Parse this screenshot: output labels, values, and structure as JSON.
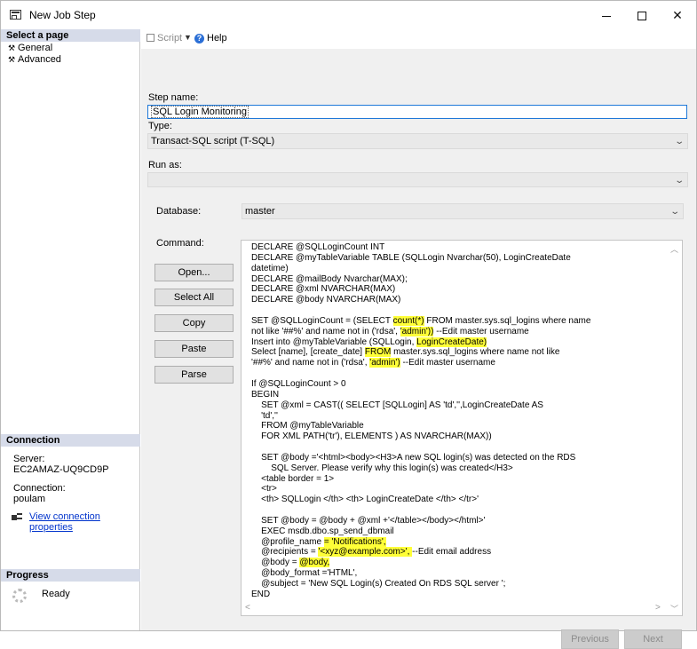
{
  "window": {
    "title": "New Job Step"
  },
  "left": {
    "select_page_header": "Select a page",
    "pages": [
      "General",
      "Advanced"
    ],
    "connection_header": "Connection",
    "server_label": "Server:",
    "server_value": "EC2AMAZ-UQ9CD9P",
    "connection_label": "Connection:",
    "connection_value": "poulam",
    "view_properties_link": "View connection properties",
    "progress_header": "Progress",
    "progress_status": "Ready"
  },
  "toolbar": {
    "script_label": "Script",
    "help_label": "Help"
  },
  "form": {
    "step_name_label": "Step name:",
    "step_name_value": "SQL Login Monitoring",
    "type_label": "Type:",
    "type_value": "Transact-SQL script (T-SQL)",
    "run_as_label": "Run as:",
    "run_as_value": "",
    "database_label": "Database:",
    "database_value": "master",
    "command_label": "Command:",
    "buttons": {
      "open": "Open...",
      "select_all": "Select All",
      "copy": "Copy",
      "paste": "Paste",
      "parse": "Parse"
    }
  },
  "command": {
    "lines": [
      [
        "DECLARE @SQLLoginCount INT"
      ],
      [
        "DECLARE @myTableVariable TABLE (SQLLogin Nvarchar(50), LoginCreateDate"
      ],
      [
        "datetime)"
      ],
      [
        "DECLARE @mailBody Nvarchar(MAX);"
      ],
      [
        "DECLARE @xml NVARCHAR(MAX)"
      ],
      [
        "DECLARE @body NVARCHAR(MAX)"
      ],
      [
        ""
      ],
      [
        "SET @SQLLoginCount = (SELECT ",
        {
          "h": "count(*)"
        },
        " FROM master.sys.sql_logins where name"
      ],
      [
        "not like '##%' and name not in ('rdsa', ",
        {
          "h": "'admin'))"
        },
        " --Edit master username"
      ],
      [
        "Insert into @myTableVariable (SQLLogin, ",
        {
          "h": "LoginCreateDate)"
        }
      ],
      [
        "Select [name], [create_date] ",
        {
          "h": "FROM"
        },
        " master.sys.sql_logins where name not like"
      ],
      [
        "'##%' and name not in ('rdsa', ",
        {
          "h": "'admin')"
        },
        " --Edit master username"
      ],
      [
        ""
      ],
      [
        "If @SQLLoginCount > 0"
      ],
      [
        "BEGIN"
      ],
      [
        "    SET @xml = CAST(( SELECT [SQLLogin] AS 'td','',LoginCreateDate AS"
      ],
      [
        "    'td',''"
      ],
      [
        "    FROM @myTableVariable"
      ],
      [
        "    FOR XML PATH('tr'), ELEMENTS ) AS NVARCHAR(MAX))"
      ],
      [
        ""
      ],
      [
        "    SET @body ='<html><body><H3>A new SQL login(s) was detected on the RDS"
      ],
      [
        "        SQL Server. Please verify why this login(s) was created</H3>"
      ],
      [
        "    <table border = 1>"
      ],
      [
        "    <tr>"
      ],
      [
        "    <th> SQLLogin </th> <th> LoginCreateDate </th> </tr>'"
      ],
      [
        ""
      ],
      [
        "    SET @body = @body + @xml +'</table></body></html>'"
      ],
      [
        "    EXEC msdb.dbo.sp_send_dbmail"
      ],
      [
        "    @profile_name ",
        {
          "h": "= 'Notifications',"
        }
      ],
      [
        "    @recipients = ",
        {
          "h": "'<xyz@example.com>', "
        },
        "--Edit email address"
      ],
      [
        "    @body = ",
        {
          "h": "@body,"
        }
      ],
      [
        "    @body_format ='HTML',"
      ],
      [
        "    @subject = 'New SQL Login(s) Created On RDS SQL server ';"
      ],
      [
        "END"
      ]
    ]
  },
  "footer": {
    "previous": "Previous",
    "next": "Next"
  },
  "colors": {
    "highlight": "#ffff38",
    "header_bg": "#d6dbe9",
    "link": "#0033cc",
    "focus_border": "#1e78d8"
  }
}
